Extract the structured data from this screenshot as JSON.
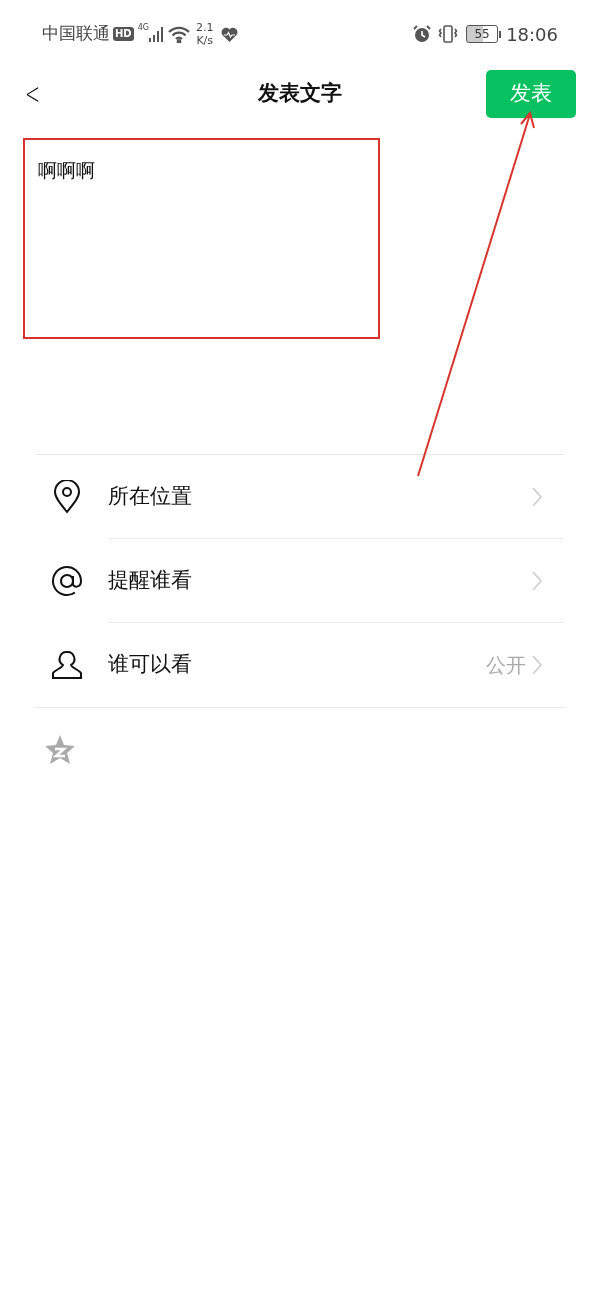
{
  "status_bar": {
    "carrier": "中国联通",
    "hd": "HD",
    "network": "4G",
    "speed_value": "2.1",
    "speed_unit": "K/s",
    "battery": "55",
    "time": "18:06"
  },
  "header": {
    "back": "<",
    "title": "发表文字",
    "post_button": "发表"
  },
  "editor": {
    "value": "啊啊啊"
  },
  "options": [
    {
      "kind": "location",
      "label": "所在位置"
    },
    {
      "kind": "mention",
      "label": "提醒谁看"
    },
    {
      "kind": "visibility",
      "label": "谁可以看",
      "value": "公开"
    }
  ]
}
